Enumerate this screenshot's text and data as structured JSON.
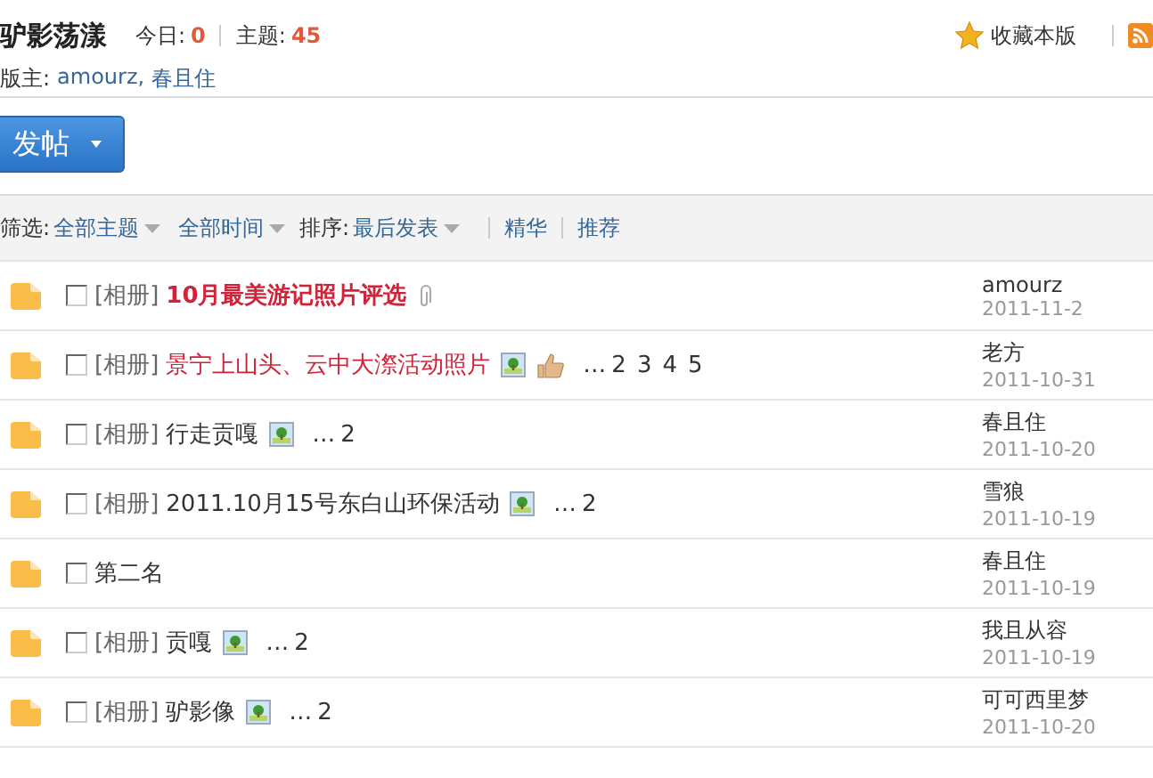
{
  "forum": {
    "title": "驴影荡漾",
    "today_label": "今日:",
    "today_count": "0",
    "topics_label": "主题:",
    "topics_count": "45",
    "moderators_label": "版主:",
    "moderators": [
      "amourz,",
      "春且住"
    ],
    "favorite": "收藏本版"
  },
  "post_button": {
    "label": "发帖"
  },
  "filter_bar": {
    "filter_label": "筛选:",
    "filters": [
      "全部主题",
      "全部时间"
    ],
    "sort_label": "排序:",
    "sort": "最后发表",
    "links": [
      "精华",
      "推荐"
    ]
  },
  "threads": [
    {
      "checked": false,
      "prefix": "[相册]",
      "title": "10月最美游记照片评选",
      "kind": "featured",
      "attachment": true,
      "image": false,
      "thumb": false,
      "author": "amourz",
      "date": "2011-11-2"
    },
    {
      "checked": false,
      "prefix": "[相册]",
      "title": "景宁上山头、云中大漈活动照片",
      "kind": "highlighted",
      "attachment": false,
      "image": true,
      "thumb": true,
      "pages": [
        "2",
        "3",
        "4",
        "5"
      ],
      "author": "老方",
      "date": "2011-10-31"
    },
    {
      "checked": false,
      "prefix": "[相册]",
      "title": "行走贡嘎",
      "kind": "plain",
      "attachment": false,
      "image": true,
      "thumb": false,
      "pages": [
        "2"
      ],
      "author": "春且住",
      "date": "2011-10-20"
    },
    {
      "checked": false,
      "prefix": "[相册]",
      "title": "2011.10月15号东白山环保活动",
      "kind": "plain",
      "attachment": false,
      "image": true,
      "thumb": false,
      "pages": [
        "2"
      ],
      "author": "雪狼",
      "date": "2011-10-19"
    },
    {
      "checked": false,
      "title": "第二名",
      "kind": "plain",
      "attachment": false,
      "image": false,
      "thumb": false,
      "author": "春且住",
      "date": "2011-10-19"
    },
    {
      "checked": false,
      "prefix": "[相册]",
      "title": "贡嘎",
      "kind": "plain",
      "attachment": false,
      "image": true,
      "thumb": false,
      "pages": [
        "2"
      ],
      "author": "我且从容",
      "date": "2011-10-19"
    },
    {
      "checked": false,
      "prefix": "[相册]",
      "title": "驴影像",
      "kind": "plain",
      "attachment": false,
      "image": true,
      "thumb": false,
      "pages": [
        "2"
      ],
      "author": "可可西里梦",
      "date": "2011-10-20"
    }
  ],
  "page_ellipsis": "…"
}
